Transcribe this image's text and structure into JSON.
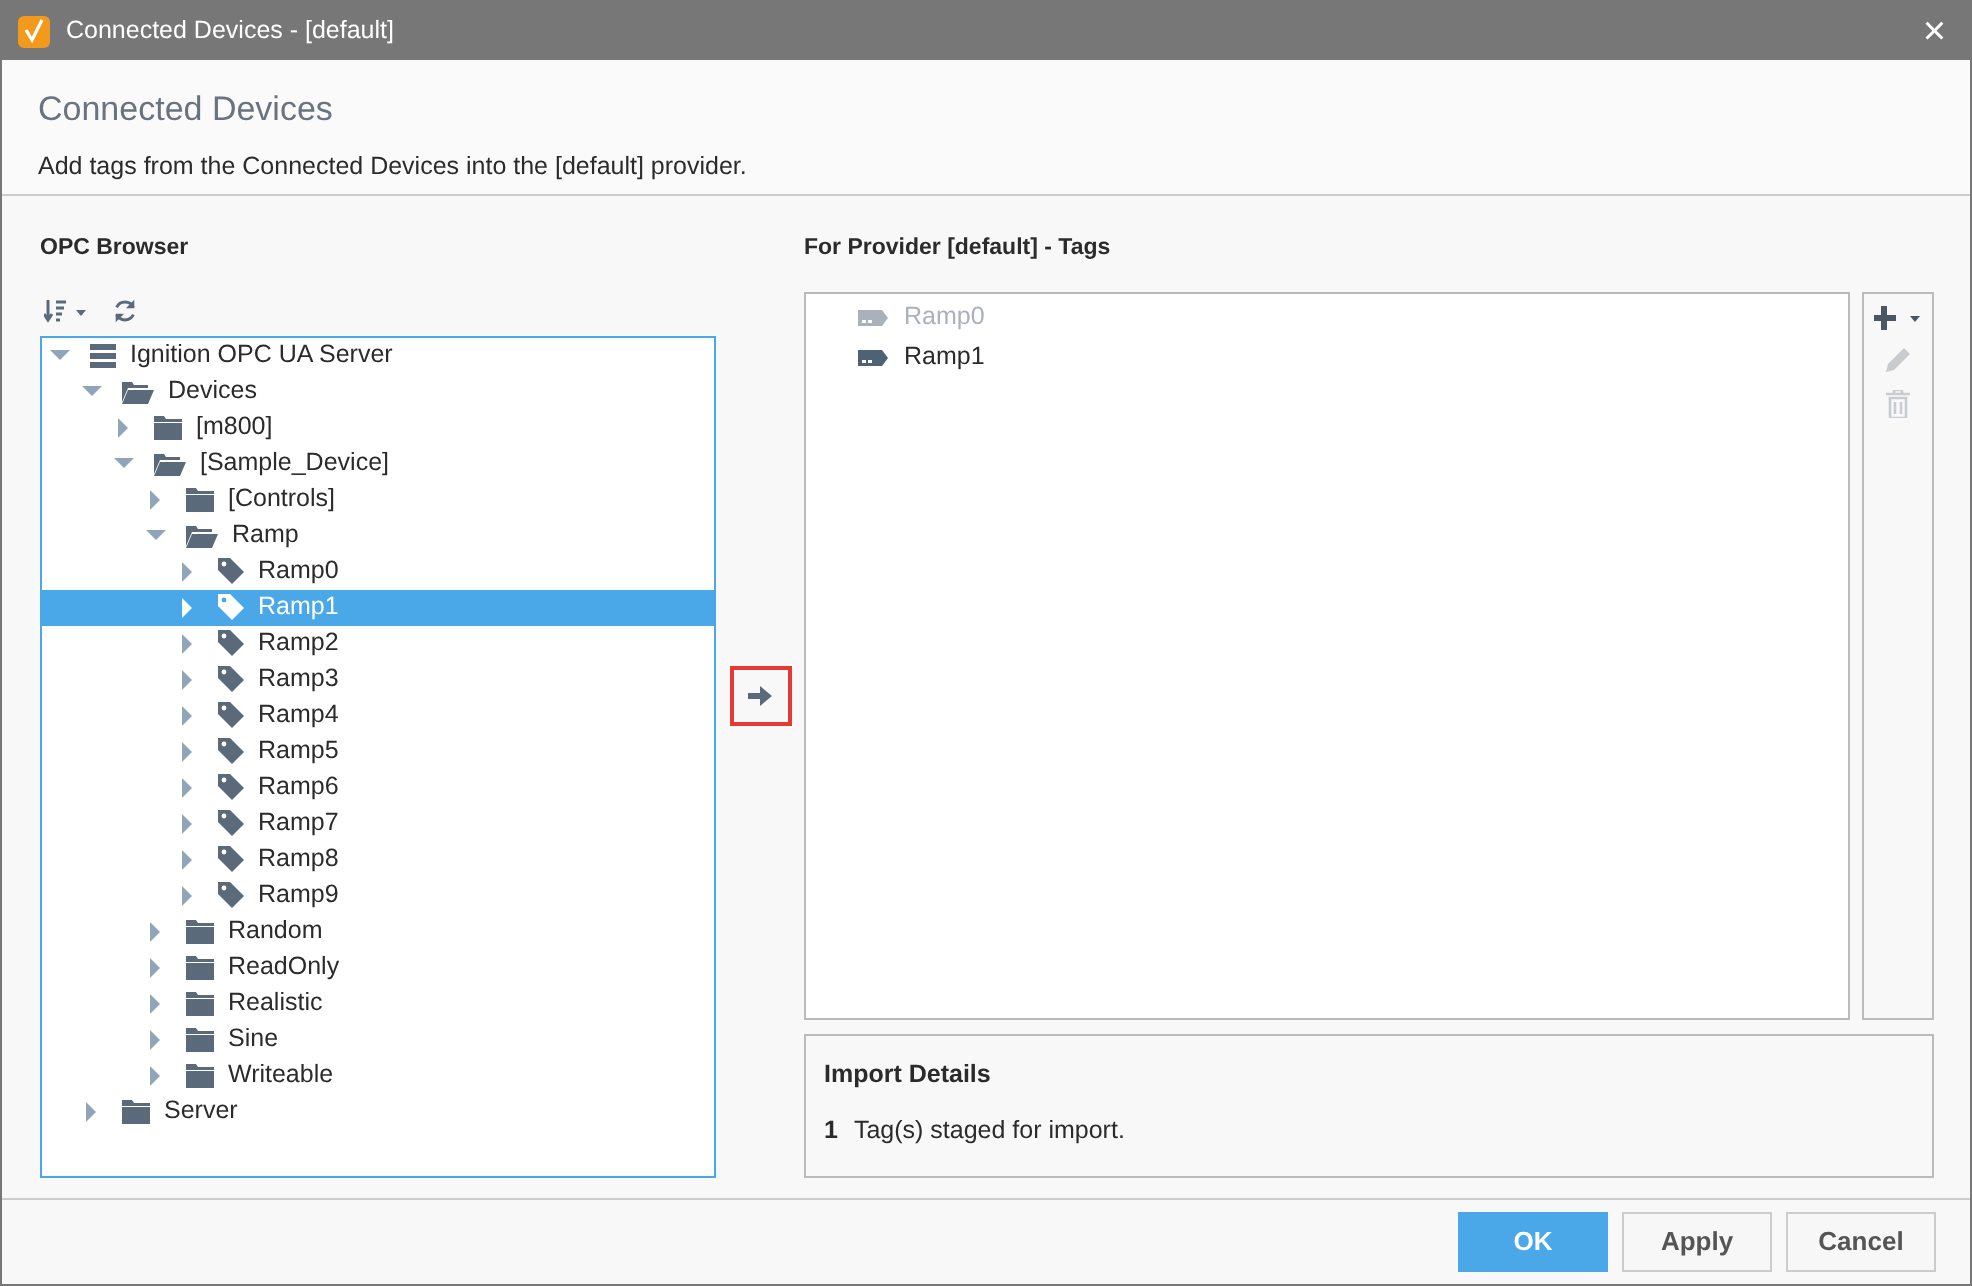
{
  "window": {
    "title": "Connected Devices - [default]",
    "close": "×"
  },
  "header": {
    "title": "Connected Devices",
    "description": "Add tags from the Connected Devices into the [default] provider."
  },
  "opc_browser": {
    "title": "OPC Browser",
    "tree": [
      {
        "label": "Ignition OPC UA Server",
        "kind": "server",
        "expanded": true,
        "selected": false,
        "children": [
          {
            "label": "Devices",
            "kind": "folder",
            "expanded": true,
            "selected": false,
            "children": [
              {
                "label": "[m800]",
                "kind": "folder",
                "expanded": false,
                "selected": false
              },
              {
                "label": "[Sample_Device]",
                "kind": "folder",
                "expanded": true,
                "selected": false,
                "children": [
                  {
                    "label": "[Controls]",
                    "kind": "folder",
                    "expanded": false,
                    "selected": false
                  },
                  {
                    "label": "Ramp",
                    "kind": "folder",
                    "expanded": true,
                    "selected": false,
                    "children": [
                      {
                        "label": "Ramp0",
                        "kind": "tag",
                        "expanded": false,
                        "selected": false
                      },
                      {
                        "label": "Ramp1",
                        "kind": "tag",
                        "expanded": false,
                        "selected": true
                      },
                      {
                        "label": "Ramp2",
                        "kind": "tag",
                        "expanded": false,
                        "selected": false
                      },
                      {
                        "label": "Ramp3",
                        "kind": "tag",
                        "expanded": false,
                        "selected": false
                      },
                      {
                        "label": "Ramp4",
                        "kind": "tag",
                        "expanded": false,
                        "selected": false
                      },
                      {
                        "label": "Ramp5",
                        "kind": "tag",
                        "expanded": false,
                        "selected": false
                      },
                      {
                        "label": "Ramp6",
                        "kind": "tag",
                        "expanded": false,
                        "selected": false
                      },
                      {
                        "label": "Ramp7",
                        "kind": "tag",
                        "expanded": false,
                        "selected": false
                      },
                      {
                        "label": "Ramp8",
                        "kind": "tag",
                        "expanded": false,
                        "selected": false
                      },
                      {
                        "label": "Ramp9",
                        "kind": "tag",
                        "expanded": false,
                        "selected": false
                      }
                    ]
                  },
                  {
                    "label": "Random",
                    "kind": "folder",
                    "expanded": false,
                    "selected": false
                  },
                  {
                    "label": "ReadOnly",
                    "kind": "folder",
                    "expanded": false,
                    "selected": false
                  },
                  {
                    "label": "Realistic",
                    "kind": "folder",
                    "expanded": false,
                    "selected": false
                  },
                  {
                    "label": "Sine",
                    "kind": "folder",
                    "expanded": false,
                    "selected": false
                  },
                  {
                    "label": "Writeable",
                    "kind": "folder",
                    "expanded": false,
                    "selected": false
                  }
                ]
              }
            ]
          },
          {
            "label": "Server",
            "kind": "folder",
            "expanded": false,
            "selected": false
          }
        ]
      }
    ]
  },
  "provider_tags": {
    "title": "For Provider [default] - Tags",
    "tags": [
      {
        "label": "Ramp0",
        "disabled": true
      },
      {
        "label": "Ramp1",
        "disabled": false
      }
    ]
  },
  "import_details": {
    "title": "Import Details",
    "count": "1",
    "message": "Tag(s) staged for import."
  },
  "buttons": [
    {
      "label": "OK",
      "primary": true
    },
    {
      "label": "Apply",
      "primary": false
    },
    {
      "label": "Cancel",
      "primary": false
    }
  ]
}
